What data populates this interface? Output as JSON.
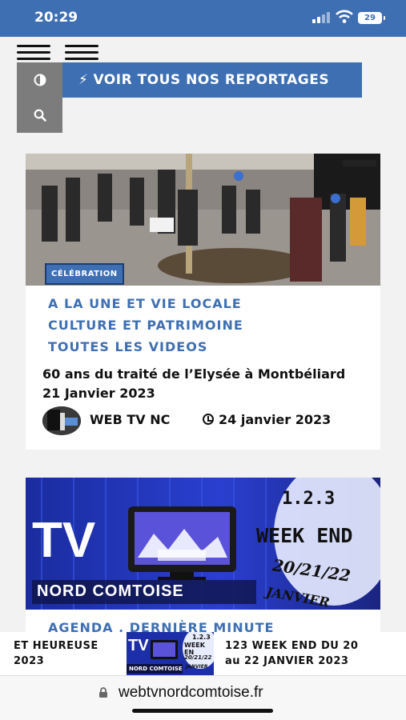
{
  "status": {
    "time": "20:29",
    "battery": "29"
  },
  "toolbar": {
    "reportages_label": "VOIR TOUS NOS REPORTAGES",
    "bolt_icon": "bolt-icon",
    "contrast_icon": "contrast-icon",
    "search_icon": "search-icon"
  },
  "article1": {
    "badge": "CÉLÉBRATION",
    "categories": [
      "A LA UNE ET VIE LOCALE",
      "CULTURE ET PATRIMOINE",
      "TOUTES LES VIDEOS"
    ],
    "title": "60 ans du traité de l’Elysée à Montbéliard 21 Janvier 2023",
    "author": "WEB TV NC",
    "date": "24 janvier 2023"
  },
  "article2": {
    "banner": {
      "tv": "TV",
      "brand": "NORD COMTOISE",
      "line1": "1.2.3",
      "line2": "WEEK END",
      "dates": "20/21/22",
      "month": "JANVIER"
    },
    "categories": [
      "AGENDA , DERNIÈRE MINUTE"
    ]
  },
  "ticker": {
    "left_line1": "ET HEUREUSE",
    "left_line2": "2023",
    "thumb_tv": "TV",
    "thumb_line1": "1.2.3",
    "thumb_line2": "WEEK EN",
    "thumb_brand": "NORD COMTOISE",
    "thumb_dates": "20/21/22",
    "thumb_month": "JANVIER",
    "right_line1": "123 WEEK END DU 20",
    "right_line2": "au 22 JANVIER 2023"
  },
  "browser": {
    "url": "webtvnordcomtoise.fr"
  },
  "colors": {
    "brand_blue": "#3e6fb3",
    "tool_grey": "#7c7c7c",
    "banner_blue": "#1d2fa8"
  }
}
